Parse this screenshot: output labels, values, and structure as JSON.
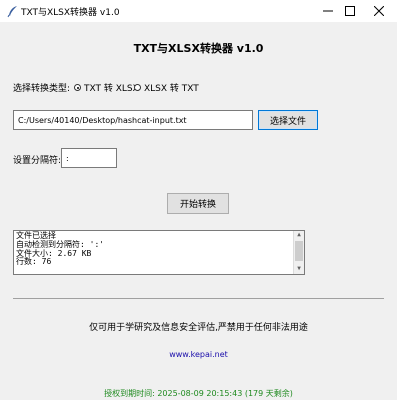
{
  "window": {
    "title": "TXT与XLSX转换器 v1.0"
  },
  "header": {
    "title": "TXT与XLSX转换器 v1.0"
  },
  "mode": {
    "label": "选择转换类型:",
    "options": [
      {
        "label": "TXT 转 XLSX",
        "selected": true
      },
      {
        "label": "XLSX 转 TXT",
        "selected": false
      }
    ]
  },
  "file": {
    "path": "C:/Users/40140/Desktop/hashcat-input.txt",
    "choose_label": "选择文件"
  },
  "separator": {
    "label": "设置分隔符:",
    "value": ":"
  },
  "actions": {
    "start_label": "开始转换"
  },
  "log": {
    "lines": [
      "文件已选择",
      "自动检测到分隔符: ':'",
      "文件大小: 2.67 KB",
      "行数: 76"
    ]
  },
  "footer": {
    "notice": "仅可用于学研究及信息安全评估,严禁用于任何非法用途",
    "website": "www.kepai.net",
    "expiry": "授权到期时间: 2025-08-09 20:15:43 (179 天剩余)"
  },
  "colors": {
    "link": "#1a0dab",
    "expiry": "#1f8a1f",
    "focus": "#0078d7"
  }
}
